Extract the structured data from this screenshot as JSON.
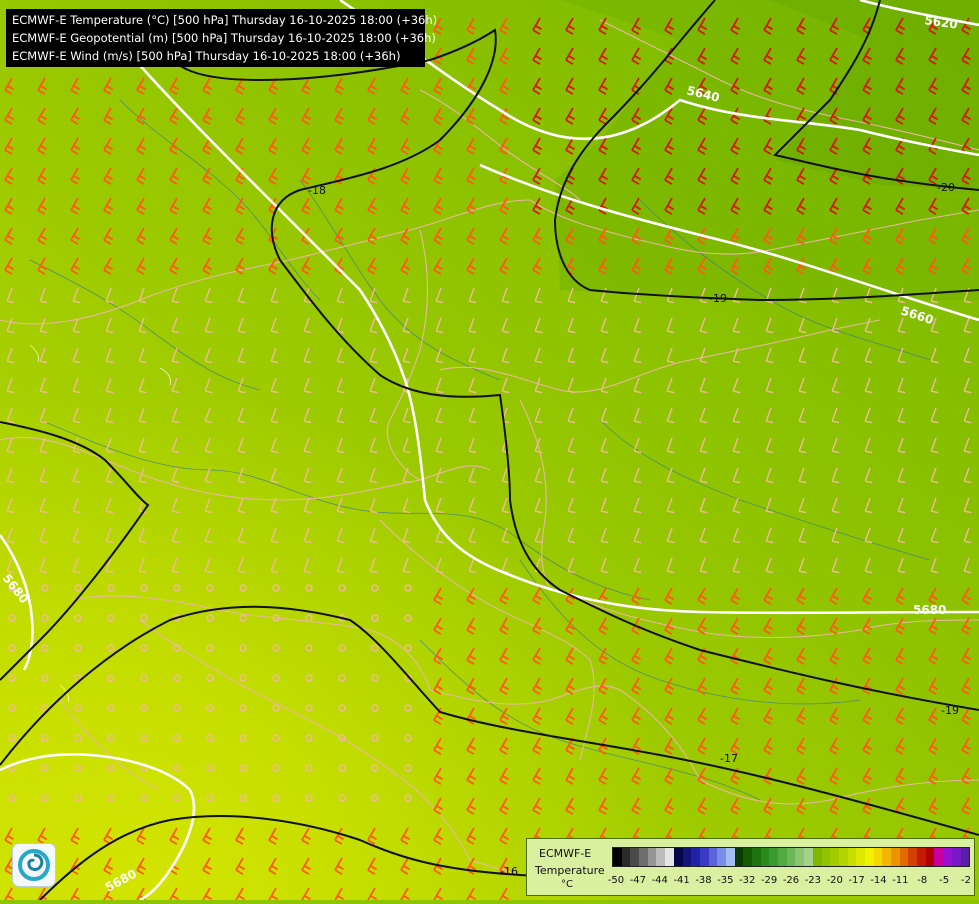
{
  "header": {
    "lines": [
      "ECMWF-E Temperature (°C) [500 hPa] Thursday 16-10-2025 18:00 (+36h)",
      "ECMWF-E Geopotential (m) [500 hPa] Thursday 16-10-2025 18:00 (+36h)",
      "ECMWF-E Wind (m/s) [500 hPa] Thursday 16-10-2025 18:00 (+36h)"
    ]
  },
  "legend": {
    "title": "ECMWF-E",
    "subtitle": "Temperature",
    "unit": "°C",
    "ticks": [
      "-50",
      "-47",
      "-44",
      "-41",
      "-38",
      "-35",
      "-32",
      "-29",
      "-26",
      "-23",
      "-20",
      "-17",
      "-14",
      "-11",
      "-8",
      "-5",
      "-2"
    ],
    "colors": [
      "#000000",
      "#2a2a2a",
      "#4a4a4a",
      "#6e6e6e",
      "#959595",
      "#bcbcbc",
      "#e6e6e6",
      "#06064a",
      "#14147a",
      "#2222a6",
      "#3a3ac4",
      "#5a64d8",
      "#7a8ee8",
      "#a0bef2",
      "#0a3a00",
      "#145a05",
      "#1e7210",
      "#2a8a1e",
      "#3a9a30",
      "#52aa44",
      "#6ab858",
      "#8ac670",
      "#a4d286",
      "#80b800",
      "#90c400",
      "#a2cc00",
      "#b4d400",
      "#c8de00",
      "#dce800",
      "#f0f000",
      "#f6d800",
      "#f2b800",
      "#ec9400",
      "#e26a00",
      "#d44000",
      "#c41a00",
      "#b00000",
      "#c800a0",
      "#9c10d0",
      "#7a18c8",
      "#5820a6"
    ]
  },
  "isotherms": [
    {
      "label": "-18"
    },
    {
      "label": "-19"
    },
    {
      "label": "-20"
    },
    {
      "label": "-19"
    },
    {
      "label": "-17"
    },
    {
      "label": "-16"
    }
  ],
  "isohypses": [
    {
      "label": "5620"
    },
    {
      "label": "5640"
    },
    {
      "label": "5660"
    },
    {
      "label": "5680"
    },
    {
      "label": "5680"
    },
    {
      "label": "5680"
    }
  ]
}
